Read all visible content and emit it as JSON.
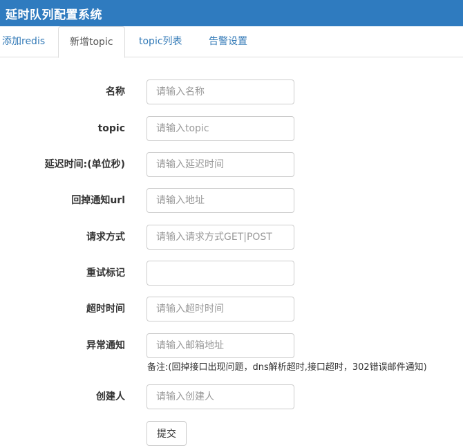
{
  "app": {
    "title": "延时队列配置系统"
  },
  "tabs": [
    {
      "label": "添加redis",
      "active": false
    },
    {
      "label": "新增topic",
      "active": true
    },
    {
      "label": "topic列表",
      "active": false
    },
    {
      "label": "告警设置",
      "active": false
    }
  ],
  "form": {
    "fields": [
      {
        "label": "名称",
        "placeholder": "请输入名称",
        "value": ""
      },
      {
        "label": "topic",
        "placeholder": "请输入topic",
        "value": ""
      },
      {
        "label": "延迟时间:(单位秒)",
        "placeholder": "请输入延迟时间",
        "value": ""
      },
      {
        "label": "回掉通知url",
        "placeholder": "请输入地址",
        "value": ""
      },
      {
        "label": "请求方式",
        "placeholder": "请输入请求方式GET|POST",
        "value": ""
      },
      {
        "label": "重试标记",
        "placeholder": "",
        "value": ""
      },
      {
        "label": "超时时间",
        "placeholder": "请输入超时时间",
        "value": ""
      },
      {
        "label": "异常通知",
        "placeholder": "请输入邮箱地址",
        "value": ""
      },
      {
        "label": "创建人",
        "placeholder": "请输入创建人",
        "value": ""
      }
    ],
    "remark": "备注:(回掉接口出现问题，dns解析超时,接口超时，302错误邮件通知)",
    "submit_label": "提交"
  },
  "colors": {
    "header_bg": "#2f7bbf",
    "link": "#337ab7",
    "border": "#cccccc"
  }
}
